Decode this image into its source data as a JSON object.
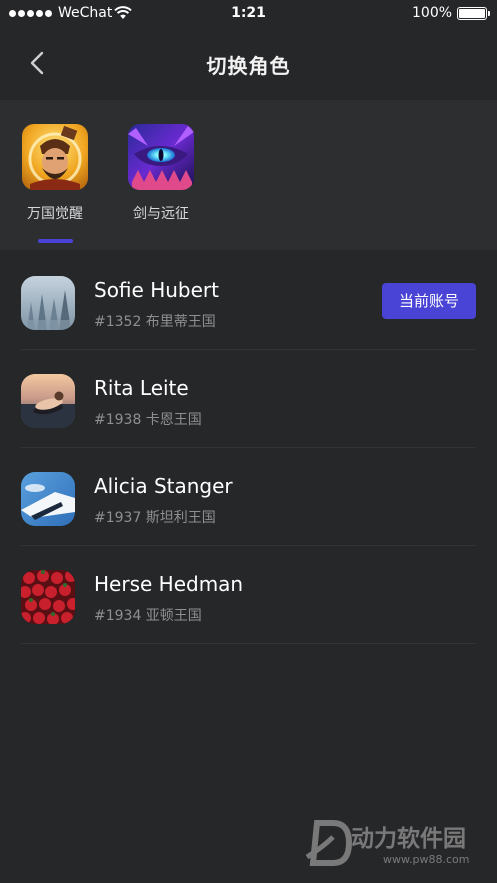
{
  "status_bar": {
    "carrier": "WeChat",
    "time": "1:21",
    "battery": "100%",
    "battery_level": 1.0
  },
  "nav": {
    "title": "切换角色",
    "back_icon": "chevron-left-icon"
  },
  "games": [
    {
      "label": "万国觉醒",
      "selected": true
    },
    {
      "label": "剑与远征",
      "selected": false
    }
  ],
  "accounts": [
    {
      "name": "Sofie Hubert",
      "sub": "#1352 布里蒂王国",
      "badge": "当前账号"
    },
    {
      "name": "Rita Leite",
      "sub": "#1938 卡恩王国"
    },
    {
      "name": "Alicia Stanger",
      "sub": "#1937 斯坦利王国"
    },
    {
      "name": "Herse Hedman",
      "sub": "#1934 亚顿王国"
    }
  ],
  "colors": {
    "background": "#262729",
    "accent": "#4a44d6",
    "subtext": "#8e8f92"
  },
  "watermark": {
    "text": "动力软件园",
    "url": "www.pw88.com"
  }
}
